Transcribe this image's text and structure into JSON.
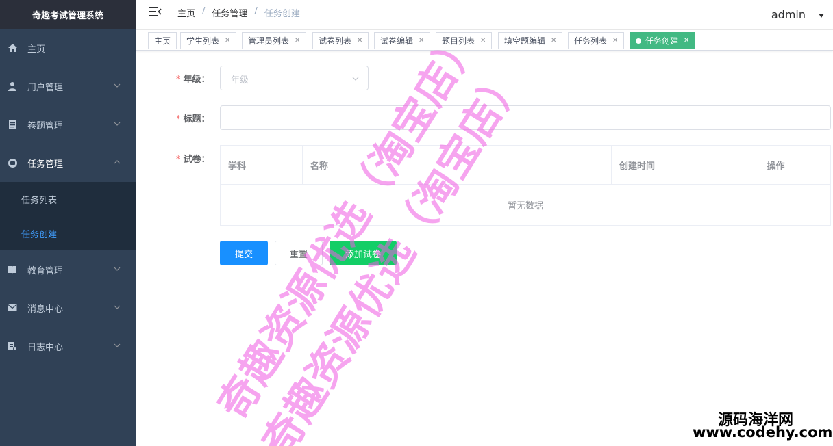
{
  "app": {
    "title": "奇趣考试管理系统"
  },
  "sidebar": {
    "items": [
      {
        "label": "主页",
        "icon": "home-icon"
      },
      {
        "label": "用户管理",
        "icon": "user-icon"
      },
      {
        "label": "卷题管理",
        "icon": "paper-icon"
      },
      {
        "label": "任务管理",
        "icon": "task-icon"
      },
      {
        "label": "教育管理",
        "icon": "book-icon"
      },
      {
        "label": "消息中心",
        "icon": "mail-icon"
      },
      {
        "label": "日志中心",
        "icon": "log-icon"
      }
    ],
    "task_submenu": [
      {
        "label": "任务列表"
      },
      {
        "label": "任务创建"
      }
    ]
  },
  "header": {
    "breadcrumb": [
      "主页",
      "任务管理",
      "任务创建"
    ],
    "user": "admin"
  },
  "tags": [
    {
      "label": "主页"
    },
    {
      "label": "学生列表"
    },
    {
      "label": "管理员列表"
    },
    {
      "label": "试卷列表"
    },
    {
      "label": "试卷编辑"
    },
    {
      "label": "题目列表"
    },
    {
      "label": "填空题编辑"
    },
    {
      "label": "任务列表"
    },
    {
      "label": "任务创建"
    }
  ],
  "form": {
    "grade_label": "年级：",
    "grade_placeholder": "年级",
    "title_label": "标题：",
    "title_value": "",
    "paper_label": "试卷："
  },
  "table": {
    "columns": [
      "学科",
      "名称",
      "创建时间",
      "操作"
    ],
    "empty_text": "暂无数据"
  },
  "buttons": {
    "submit": "提交",
    "reset": "重置",
    "add_paper": "添加试卷"
  },
  "watermark": {
    "line1": "奇趣资源优选（淘宝店）",
    "line2": "奇趣资源优选（淘宝店）",
    "corner_line1": "源码海洋网",
    "corner_line2": "www.codehy.com"
  },
  "colors": {
    "sidebar_bg": "#304156",
    "active_menu": "#409eff",
    "active_tag": "#42b983",
    "primary": "#1890ff",
    "success": "#13ce66"
  }
}
